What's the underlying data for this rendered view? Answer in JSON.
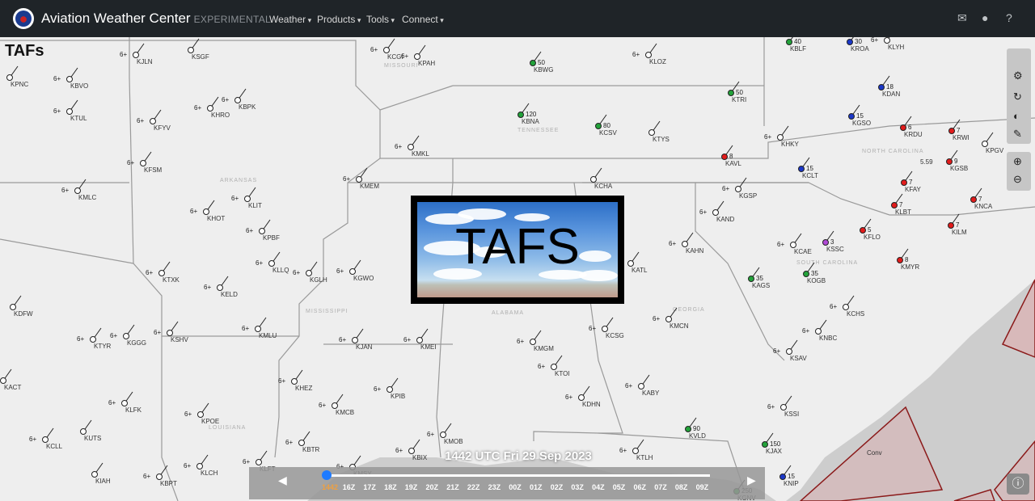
{
  "navbar": {
    "brand": "Aviation Weather Center",
    "badge": "EXPERIMENTAL",
    "menus": [
      "Weather",
      "Products",
      "Tools",
      "Connect"
    ],
    "icons": [
      "mail-icon",
      "user-icon",
      "help-icon"
    ]
  },
  "page": {
    "title": "TAFs"
  },
  "overlay": {
    "text": "TAFS"
  },
  "map_controls": [
    "settings-icon",
    "refresh-icon",
    "pencil-icon",
    "zoom-in-icon",
    "zoom-out-icon"
  ],
  "timeline": {
    "label": "1442 UTC Fri 29 Sep 2023",
    "ticks": [
      "1442",
      "16Z",
      "17Z",
      "18Z",
      "19Z",
      "20Z",
      "21Z",
      "22Z",
      "23Z",
      "00Z",
      "01Z",
      "02Z",
      "03Z",
      "04Z",
      "05Z",
      "06Z",
      "07Z",
      "08Z",
      "09Z"
    ],
    "active": "1442"
  },
  "states": [
    "MISSOURI",
    "TENNESSEE",
    "ARKANSAS",
    "MISSISSIPPI",
    "ALABAMA",
    "GEORGIA",
    "LOUISIANA",
    "NORTH CAROLINA",
    "SOUTH CAROLINA"
  ],
  "region_label": "Conv",
  "stations": [
    {
      "id": "KJLN",
      "v": "6+"
    },
    {
      "id": "KSGF",
      "v": ""
    },
    {
      "id": "KCGI",
      "v": "6+"
    },
    {
      "id": "KPAH",
      "v": "6+"
    },
    {
      "id": "KBWG",
      "v": "50"
    },
    {
      "id": "KLOZ",
      "v": "6+"
    },
    {
      "id": "KBLF",
      "v": "40"
    },
    {
      "id": "KROA",
      "v": "30"
    },
    {
      "id": "KLYH",
      "v": "6+"
    },
    {
      "id": "KPNC",
      "v": ""
    },
    {
      "id": "KBVO",
      "v": "6+"
    },
    {
      "id": "KHRO",
      "v": "6+"
    },
    {
      "id": "KBPK",
      "v": "6+"
    },
    {
      "id": "KTRI",
      "v": "50"
    },
    {
      "id": "KDAN",
      "v": "18"
    },
    {
      "id": "KTUL",
      "v": "6+"
    },
    {
      "id": "KFYV",
      "v": "6+"
    },
    {
      "id": "KBNA",
      "v": "120"
    },
    {
      "id": "KCSV",
      "v": "80"
    },
    {
      "id": "KGSO",
      "v": "15"
    },
    {
      "id": "KRDU",
      "v": "6"
    },
    {
      "id": "KRWI",
      "v": "7"
    },
    {
      "id": "KFSM",
      "v": "6+"
    },
    {
      "id": "KMKL",
      "v": "6+"
    },
    {
      "id": "KTYS",
      "v": ""
    },
    {
      "id": "KHKY",
      "v": "6+"
    },
    {
      "id": "KAVL",
      "v": "8"
    },
    {
      "id": "KCLT",
      "v": "15"
    },
    {
      "id": "KGSB",
      "v": "9"
    },
    {
      "id": "KPGV",
      "v": ""
    },
    {
      "id": "KMLC",
      "v": "6+"
    },
    {
      "id": "KMEM",
      "v": "6+"
    },
    {
      "id": "KCHA",
      "v": ""
    },
    {
      "id": "KFAY",
      "v": "7"
    },
    {
      "id": "KNCA",
      "v": "7"
    },
    {
      "id": "KHOT",
      "v": "6+"
    },
    {
      "id": "KLIT",
      "v": "6+"
    },
    {
      "id": "KGSP",
      "v": "6+"
    },
    {
      "id": "KLBT",
      "v": "7"
    },
    {
      "id": "KPBF",
      "v": "6+"
    },
    {
      "id": "KAND",
      "v": "6+"
    },
    {
      "id": "KFLO",
      "v": "5"
    },
    {
      "id": "KILM",
      "v": "7"
    },
    {
      "id": "KLLQ",
      "v": "6+"
    },
    {
      "id": "KGLH",
      "v": "6+"
    },
    {
      "id": "KGWO",
      "v": "6+"
    },
    {
      "id": "KATL",
      "v": ""
    },
    {
      "id": "KAHN",
      "v": "6+"
    },
    {
      "id": "KCAE",
      "v": "6+"
    },
    {
      "id": "KSSC",
      "v": "3"
    },
    {
      "id": "KMYR",
      "v": "8"
    },
    {
      "id": "KTXK",
      "v": "6+"
    },
    {
      "id": "KELD",
      "v": "6+"
    },
    {
      "id": "KAGS",
      "v": "35"
    },
    {
      "id": "KOGB",
      "v": "35"
    },
    {
      "id": "KDFW",
      "v": ""
    },
    {
      "id": "KCHS",
      "v": "6+"
    },
    {
      "id": "KMCN",
      "v": "6+"
    },
    {
      "id": "KCSG",
      "v": "6+"
    },
    {
      "id": "KTYR",
      "v": "6+"
    },
    {
      "id": "KGGG",
      "v": "6+"
    },
    {
      "id": "KSHV",
      "v": "6+"
    },
    {
      "id": "KMLU",
      "v": "6+"
    },
    {
      "id": "KJAN",
      "v": "6+"
    },
    {
      "id": "KMEI",
      "v": "6+"
    },
    {
      "id": "KMGM",
      "v": "6+"
    },
    {
      "id": "KNBC",
      "v": "6+"
    },
    {
      "id": "KACT",
      "v": ""
    },
    {
      "id": "KTOI",
      "v": "6+"
    },
    {
      "id": "KSAV",
      "v": "6+"
    },
    {
      "id": "KHEZ",
      "v": "6+"
    },
    {
      "id": "KPIB",
      "v": "6+"
    },
    {
      "id": "KABY",
      "v": "6+"
    },
    {
      "id": "KLFK",
      "v": "6+"
    },
    {
      "id": "KPOE",
      "v": "6+"
    },
    {
      "id": "KMCB",
      "v": "6+"
    },
    {
      "id": "KDHN",
      "v": "6+"
    },
    {
      "id": "KSSI",
      "v": "6+"
    },
    {
      "id": "KCLL",
      "v": "6+"
    },
    {
      "id": "KUTS",
      "v": ""
    },
    {
      "id": "KBTR",
      "v": "6+"
    },
    {
      "id": "KVLD",
      "v": "90"
    },
    {
      "id": "KIAH",
      "v": ""
    },
    {
      "id": "KLCH",
      "v": "6+"
    },
    {
      "id": "KLFT",
      "v": "6+"
    },
    {
      "id": "KMSY",
      "v": "6+"
    },
    {
      "id": "KBIX",
      "v": "6+"
    },
    {
      "id": "KMOB",
      "v": "6+"
    },
    {
      "id": "KTLH",
      "v": "6+"
    },
    {
      "id": "KJAX",
      "v": "150"
    },
    {
      "id": "KBPT",
      "v": "6+"
    },
    {
      "id": "KGNV",
      "v": "250"
    },
    {
      "id": "KNIP",
      "v": "15"
    }
  ],
  "special_values": [
    "5.59"
  ]
}
